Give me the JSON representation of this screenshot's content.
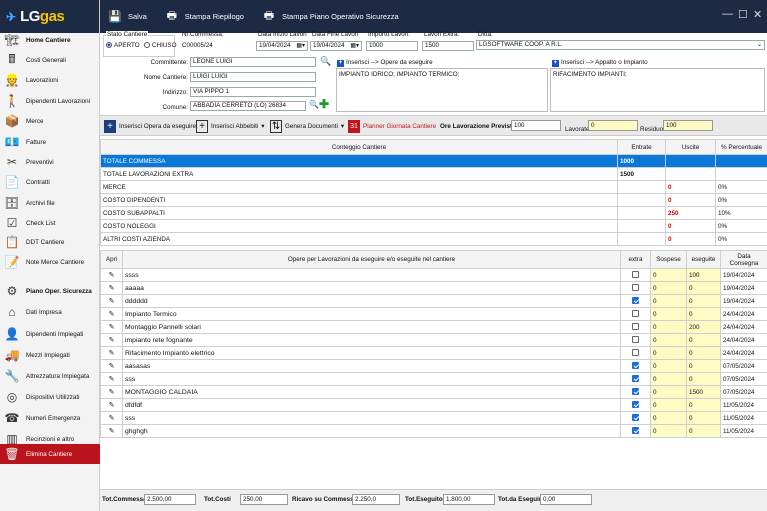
{
  "app": {
    "logo_text": "LG",
    "logo_accent": "gas"
  },
  "toolbar": {
    "save_label": "Salva",
    "print_summary_label": "Stampa Riepilogo",
    "print_safety_label": "Stampa Piano Operativo Sicurezza"
  },
  "sidebar": {
    "items": [
      {
        "label": "Home Cantiere",
        "icon": "home-site-icon",
        "highlight": false,
        "bold": true
      },
      {
        "label": "Costi Generali",
        "icon": "costs-icon"
      },
      {
        "label": "Lavorazioni",
        "icon": "worker-icon"
      },
      {
        "label": "Dipendenti Lavorazioni",
        "icon": "employee-icon"
      },
      {
        "label": "Merce",
        "icon": "goods-icon"
      },
      {
        "label": "Fatture",
        "icon": "invoice-icon"
      },
      {
        "label": "Preventivi",
        "icon": "quote-icon"
      },
      {
        "label": "Contratti",
        "icon": "contract-icon"
      },
      {
        "label": "Archivi file",
        "icon": "archive-icon"
      },
      {
        "label": "Check List",
        "icon": "checklist-icon"
      },
      {
        "label": "DDT Cantiere",
        "icon": "ddt-icon"
      },
      {
        "label": "Note Merce Cantiere",
        "icon": "note-icon"
      },
      {
        "label": "Piano Oper. Sicurezza",
        "icon": "gear-icon",
        "bold": true
      },
      {
        "label": "Dati Impresa",
        "icon": "company-icon"
      },
      {
        "label": "Dipendenti Impiegati",
        "icon": "staff-icon"
      },
      {
        "label": "Mezzi Impiegati",
        "icon": "vehicle-icon"
      },
      {
        "label": "Attrezzatura Impiegata",
        "icon": "tool-icon"
      },
      {
        "label": "Dispositivi Utilizzati",
        "icon": "device-icon"
      },
      {
        "label": "Numeri Emergenza",
        "icon": "phone-icon"
      },
      {
        "label": "Recinzioni e altro",
        "icon": "fence-icon"
      },
      {
        "label": "Elimina Cantiere",
        "icon": "trash-icon",
        "highlight": true
      }
    ]
  },
  "form": {
    "stato_label": "Stato Cantiere",
    "aperto_label": "APERTO",
    "chiuso_label": "CHIUSO",
    "nr_commessa_label": "Nr.Commessa:",
    "nr_commessa_value": "C00005/24",
    "data_inizio_label": "Data Inizio Lavori",
    "data_inizio_value": "19/04/2024",
    "data_fine_label": "Data Fine Lavori",
    "data_fine_value": "19/04/2024",
    "importo_label": "Importo Lavori:",
    "importo_value": "1000",
    "lavori_extra_label": "Lavori Extra:",
    "lavori_extra_value": "1500",
    "ditta_label": "Ditta:",
    "ditta_value": "LGSOFTWARE COOP. A R.L.",
    "committente_label": "Committente:",
    "committente_value": "LEONE LUIGI",
    "nome_cantiere_label": "Nome Cantiere:",
    "nome_cantiere_value": "LUIGI LUIGI",
    "indirizzo_label": "Indirizzo:",
    "indirizzo_value": "VIA PIPPO 1",
    "comune_label": "Comune:",
    "comune_value": "ABBADIA CERRETO (LO) 26834",
    "opere_header": "Inserisci  --> Opere da eseguire",
    "opere_text": "IMPIANTO IDRICO; IMPIANTO TERMICO;",
    "appalto_header": "Inserisci  --> Appalto o Impianto",
    "appalto_text": "RIFACIMENTO IMPIANTI;"
  },
  "toolbar2": {
    "insert_opera": "Inserisci Opera da eseguire",
    "insert_abbediti": "Inserisci Abbebiti",
    "genera_documenti": "Genera Documenti",
    "planner": "Planner Giornata Cantiere",
    "ore_previste_label": "Ore Lavorazione Previste",
    "ore_previste_value": "100",
    "lavorate_label": "Lavorate",
    "lavorate_value": "0",
    "residuo_label": "Residuo",
    "residuo_value": "100"
  },
  "conteggio": {
    "headers": [
      "Conteggio Cantiere",
      "Entrate",
      "Uscite",
      "% Percentuale"
    ],
    "rows": [
      {
        "label": "TOTALE COMMESSA",
        "entrate": "1000",
        "uscite": "",
        "perc": "",
        "selected": true
      },
      {
        "label": "TOTALE LAVORAZIONI EXTRA",
        "entrate": "1500",
        "uscite": "",
        "perc": ""
      },
      {
        "label": "MERCE",
        "entrate": "",
        "uscite": "0",
        "perc": "0%"
      },
      {
        "label": "COSTO DIPENDENTI",
        "entrate": "",
        "uscite": "0",
        "perc": "0%"
      },
      {
        "label": "COSTO SUBAPPALTI",
        "entrate": "",
        "uscite": "250",
        "perc": "10%"
      },
      {
        "label": "COSTO NOLEGGI",
        "entrate": "",
        "uscite": "0",
        "perc": "0%"
      },
      {
        "label": "ALTRI COSTI AZIENDA",
        "entrate": "",
        "uscite": "0",
        "perc": "0%"
      }
    ]
  },
  "opere": {
    "headers": [
      "Apri",
      "Opere per Lavorazioni da eseguire e/o eseguite nel cantiere",
      "extra",
      "Sospese",
      "eseguite",
      "Data Consegna"
    ],
    "rows": [
      {
        "name": "ssss",
        "extra": false,
        "sospese": "0",
        "eseguite": "100",
        "data": "19/04/2024"
      },
      {
        "name": "aaaaa",
        "extra": false,
        "sospese": "0",
        "eseguite": "0",
        "data": "19/04/2024"
      },
      {
        "name": "dddddd",
        "extra": true,
        "sospese": "0",
        "eseguite": "0",
        "data": "19/04/2024"
      },
      {
        "name": "Impianto Termico",
        "extra": false,
        "sospese": "0",
        "eseguite": "0",
        "data": "24/04/2024"
      },
      {
        "name": "Montaggio Pannelli solari",
        "extra": false,
        "sospese": "0",
        "eseguite": "200",
        "data": "24/04/2024"
      },
      {
        "name": "impianto rete fognante",
        "extra": false,
        "sospese": "0",
        "eseguite": "0",
        "data": "24/04/2024"
      },
      {
        "name": "Rifacimento Impianto elettrico",
        "extra": false,
        "sospese": "0",
        "eseguite": "0",
        "data": "24/04/2024"
      },
      {
        "name": "aasasas",
        "extra": true,
        "sospese": "0",
        "eseguite": "0",
        "data": "07/05/2024"
      },
      {
        "name": "sss",
        "extra": true,
        "sospese": "0",
        "eseguite": "0",
        "data": "07/05/2024"
      },
      {
        "name": "MONTAGGIO CALDAIA",
        "extra": true,
        "sospese": "0",
        "eseguite": "1500",
        "data": "07/05/2024"
      },
      {
        "name": "dfdfdf",
        "extra": true,
        "sospese": "0",
        "eseguite": "0",
        "data": "11/05/2024"
      },
      {
        "name": "sss",
        "extra": true,
        "sospese": "0",
        "eseguite": "0",
        "data": "11/05/2024"
      },
      {
        "name": "ghghgh",
        "extra": true,
        "sospese": "0",
        "eseguite": "0",
        "data": "11/05/2024"
      }
    ]
  },
  "footer": {
    "tot_commessa_label": "Tot.Commessa",
    "tot_commessa_value": "2.500,00",
    "tot_costi_label": "Tot.Costi",
    "tot_costi_value": "250,00",
    "ricavo_label": "Ricavo su Commessa",
    "ricavo_value": "2.250,0",
    "tot_eseguito_label": "Tot.Eseguito",
    "tot_eseguito_value": "1.800,00",
    "tot_da_eseguire_label": "Tot.da Eseguire",
    "tot_da_eseguire_value": "0,00"
  },
  "colors": {
    "header_bg": "#1c2a43",
    "highlight_red": "#b9141c",
    "selected_blue": "#0a78d7",
    "yellow_cell": "#fffbc5"
  }
}
